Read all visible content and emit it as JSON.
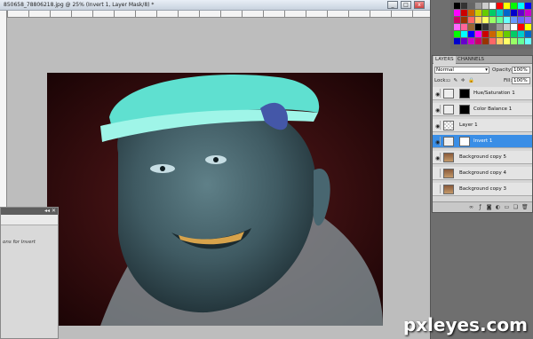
{
  "document": {
    "title": "850658_78806218.jpg @ 25% (Invert 1, Layer Mask/8) *",
    "window_buttons": [
      "_",
      "□",
      "x"
    ]
  },
  "side_panel": {
    "text": "ons for Invert",
    "header_buttons": "◂◂ ✕"
  },
  "layers_panel": {
    "tabs": [
      "LAYERS",
      "CHANNELS"
    ],
    "active_tab": "LAYERS",
    "blend_mode": "Normal",
    "opacity_label": "Opacity:",
    "opacity_value": "100%",
    "lock_label": "Lock:",
    "fill_label": "Fill:",
    "fill_value": "100%",
    "layers": [
      {
        "name": "Hue/Saturation 1",
        "visible": true,
        "selected": false,
        "type": "adjustment"
      },
      {
        "name": "Color Balance 1",
        "visible": true,
        "selected": false,
        "type": "adjustment"
      },
      {
        "name": "Layer 1",
        "visible": true,
        "selected": false,
        "type": "pixel"
      },
      {
        "name": "Invert 1",
        "visible": true,
        "selected": true,
        "type": "adjustment"
      },
      {
        "name": "Background copy 5",
        "visible": true,
        "selected": false,
        "type": "pixel"
      },
      {
        "name": "Background copy 4",
        "visible": false,
        "selected": false,
        "type": "pixel"
      },
      {
        "name": "Background copy 3",
        "visible": false,
        "selected": false,
        "type": "pixel"
      }
    ]
  },
  "watermark": "pxleyes.com",
  "colors": {
    "selected_layer": "#3a8ee6",
    "panel_bg": "#d6d6d6",
    "photo_bg": "#2a0a0c"
  }
}
